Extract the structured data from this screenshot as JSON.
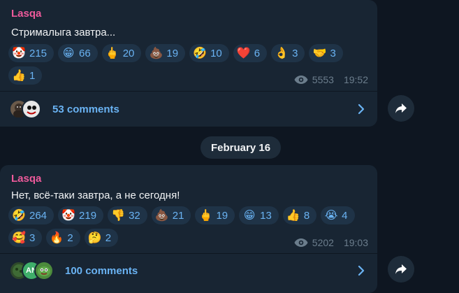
{
  "posts": [
    {
      "author": "Lasqa",
      "text": "Стрималыга завтра...",
      "reactions": [
        {
          "emoji": "🤡",
          "icon": "clown-face-icon",
          "count": "215"
        },
        {
          "emoji": "😁",
          "icon": "grinning-face-icon",
          "count": "66"
        },
        {
          "emoji": "🖕",
          "icon": "middle-finger-icon",
          "count": "20"
        },
        {
          "emoji": "💩",
          "icon": "poop-icon",
          "count": "19"
        },
        {
          "emoji": "🤣",
          "icon": "rofl-face-icon",
          "count": "10"
        },
        {
          "emoji": "❤️",
          "icon": "red-heart-icon",
          "count": "6"
        },
        {
          "emoji": "👌",
          "icon": "ok-hand-icon",
          "count": "3"
        },
        {
          "emoji": "🤝",
          "icon": "handshake-icon",
          "count": "3"
        },
        {
          "emoji": "👍",
          "icon": "thumbs-up-icon",
          "count": "1"
        }
      ],
      "views": "5553",
      "time": "19:52",
      "comments_label": "53 comments"
    },
    {
      "author": "Lasqa",
      "text": "Нет, всё-таки завтра, а не сегодня!",
      "reactions": [
        {
          "emoji": "🤣",
          "icon": "rofl-face-icon",
          "count": "264"
        },
        {
          "emoji": "🤡",
          "icon": "clown-face-icon",
          "count": "219"
        },
        {
          "emoji": "👎",
          "icon": "thumbs-down-icon",
          "count": "32"
        },
        {
          "emoji": "💩",
          "icon": "poop-icon",
          "count": "21"
        },
        {
          "emoji": "🖕",
          "icon": "middle-finger-icon",
          "count": "19"
        },
        {
          "emoji": "😁",
          "icon": "grinning-face-icon",
          "count": "13"
        },
        {
          "emoji": "👍",
          "icon": "thumbs-up-icon",
          "count": "8"
        },
        {
          "emoji": "😭",
          "icon": "crying-face-icon",
          "count": "4"
        },
        {
          "emoji": "🥰",
          "icon": "smiling-face-hearts-icon",
          "count": "3"
        },
        {
          "emoji": "🔥",
          "icon": "fire-icon",
          "count": "2"
        },
        {
          "emoji": "🤔",
          "icon": "thinking-face-icon",
          "count": "2"
        }
      ],
      "views": "5202",
      "time": "19:03",
      "comments_label": "100 comments",
      "avatar_initials": "AN"
    }
  ],
  "date_separator": "February 16",
  "colors": {
    "background": "#0e1621",
    "bubble": "#182533",
    "author": "#ee5a9b",
    "accent": "#6ab3f3",
    "meta": "#6b7d8c"
  }
}
